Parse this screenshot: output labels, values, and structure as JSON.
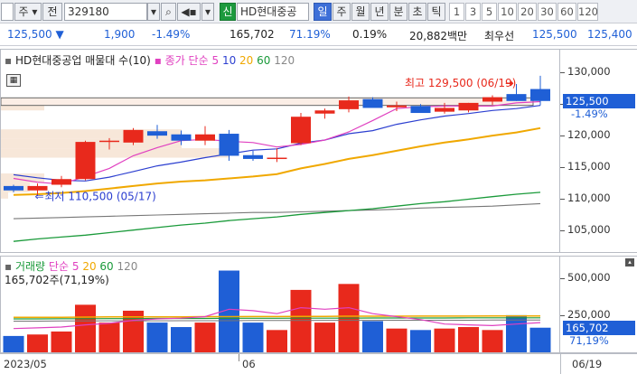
{
  "toolbar": {
    "menu_label": "주",
    "prev_label": "전",
    "code": "329180",
    "new_badge": "신",
    "stock_name": "HD현대중공",
    "periods": [
      "일",
      "주",
      "월",
      "년",
      "분",
      "초",
      "틱"
    ],
    "active_period": "일",
    "intervals": [
      "1",
      "3",
      "5",
      "10",
      "20",
      "30",
      "60",
      "120"
    ]
  },
  "quote": {
    "price": "125,500",
    "change": "1,900",
    "change_pct": "-1.49%",
    "volume": "165,702",
    "vol_ratio": "71.19%",
    "turnover": "0.19%",
    "amount": "20,882백만",
    "best_label": "최우선",
    "ask": "125,500",
    "bid": "125,400"
  },
  "price_pane": {
    "title": "HD현대중공업 매물대 수(10)",
    "ma_label": "종가 단순",
    "ma_periods": [
      "5",
      "10",
      "20",
      "60",
      "120"
    ],
    "max_annotation": "최고 129,500 (06/19)",
    "min_annotation": "최저 110,500 (05/17)",
    "current_price_tag": "125,500",
    "current_pct_tag": "-1.49%"
  },
  "volume_pane": {
    "title": "거래량",
    "ma_label": "단순",
    "ma_periods": [
      "5",
      "20",
      "60",
      "120"
    ],
    "current_info": "165,702주(71,19%)",
    "current_tag": "165,702",
    "current_pct_tag": "71,19%"
  },
  "date_axis": {
    "start": "2023/05",
    "mid": "06",
    "end": "06/19"
  },
  "colors": {
    "up": "#e8291c",
    "down": "#1f5fd6",
    "ma5": "#e040c0",
    "ma10": "#2c3fd0",
    "ma20": "#f0a800",
    "ma60": "#1a9a3a",
    "ma120": "#777777"
  },
  "chart_data": {
    "type": "candlestick",
    "dates": [
      "05/16",
      "05/17",
      "05/18",
      "05/19",
      "05/22",
      "05/23",
      "05/24",
      "05/25",
      "05/26",
      "05/30",
      "05/31",
      "06/01",
      "06/02",
      "06/05",
      "06/07",
      "06/08",
      "06/09",
      "06/12",
      "06/13",
      "06/14",
      "06/15",
      "06/16",
      "06/19"
    ],
    "ohlc": [
      [
        112000,
        112200,
        111000,
        111300
      ],
      [
        111300,
        112400,
        110500,
        112000
      ],
      [
        112200,
        113600,
        111800,
        113100
      ],
      [
        113100,
        119200,
        112900,
        119000
      ],
      [
        119000,
        119600,
        117800,
        119200
      ],
      [
        118900,
        121200,
        118500,
        120900
      ],
      [
        120700,
        121700,
        119500,
        120000
      ],
      [
        120200,
        120800,
        118500,
        119200
      ],
      [
        119200,
        121500,
        118500,
        120200
      ],
      [
        120300,
        120900,
        116000,
        116800
      ],
      [
        116900,
        117600,
        116000,
        116300
      ],
      [
        116300,
        118000,
        115800,
        116500
      ],
      [
        118800,
        123600,
        118500,
        123000
      ],
      [
        123500,
        124300,
        122700,
        124000
      ],
      [
        124200,
        126200,
        123700,
        125600
      ],
      [
        125800,
        126100,
        124600,
        124400
      ],
      [
        124500,
        125400,
        123900,
        124800
      ],
      [
        124700,
        125000,
        123600,
        123600
      ],
      [
        123800,
        125200,
        123500,
        124400
      ],
      [
        124000,
        125200,
        123700,
        125200
      ],
      [
        125400,
        126400,
        124900,
        126100
      ],
      [
        126600,
        128200,
        125500,
        125500
      ],
      [
        127400,
        129500,
        124800,
        125500
      ]
    ],
    "ma": {
      "5": [
        113200,
        112600,
        112300,
        113500,
        114800,
        116800,
        118100,
        119200,
        119400,
        119100,
        118900,
        118200,
        118600,
        119300,
        120600,
        122400,
        124300,
        124600,
        124700,
        124700,
        124700,
        125200,
        125400
      ],
      "10": [
        113800,
        113300,
        112900,
        112800,
        113400,
        114300,
        115200,
        115800,
        116500,
        117100,
        117700,
        117900,
        118800,
        119300,
        120300,
        120800,
        121800,
        122500,
        123100,
        123500,
        124000,
        124300,
        124800
      ],
      "20": [
        110600,
        110700,
        110900,
        111200,
        111600,
        112000,
        112400,
        112700,
        112900,
        113200,
        113500,
        113900,
        114800,
        115500,
        116300,
        116900,
        117600,
        118300,
        118900,
        119400,
        120000,
        120500,
        121200
      ],
      "60": [
        103200,
        103600,
        103900,
        104200,
        104600,
        105000,
        105400,
        105800,
        106100,
        106500,
        106800,
        107100,
        107500,
        107800,
        108100,
        108400,
        108800,
        109200,
        109500,
        109900,
        110300,
        110700,
        111000
      ],
      "120": [
        106800,
        106900,
        107000,
        107100,
        107200,
        107300,
        107400,
        107500,
        107600,
        107700,
        107800,
        107800,
        107900,
        108000,
        108100,
        108200,
        108300,
        108500,
        108600,
        108700,
        108800,
        109000,
        109200
      ]
    },
    "volume": [
      110000,
      120000,
      140000,
      320000,
      200000,
      280000,
      200000,
      170000,
      200000,
      550000,
      200000,
      150000,
      420000,
      200000,
      460000,
      210000,
      160000,
      150000,
      160000,
      170000,
      150000,
      250000,
      165702
    ],
    "vol_ma5": [
      160000,
      165000,
      170000,
      185000,
      195000,
      215000,
      225000,
      230000,
      240000,
      290000,
      280000,
      260000,
      300000,
      290000,
      300000,
      260000,
      240000,
      220000,
      190000,
      185000,
      180000,
      190000,
      200000
    ],
    "vol_ma20": [
      235000,
      235000,
      236000,
      237000,
      238000,
      238000,
      239000,
      239000,
      240000,
      240000,
      241000,
      241000,
      242000,
      242000,
      243000,
      243000,
      243000,
      244000,
      244000,
      244000,
      245000,
      245000,
      245000
    ],
    "vol_ma60": [
      225000,
      225000,
      226000,
      226000,
      227000,
      227000,
      228000,
      228000,
      228000,
      229000,
      229000,
      229000,
      230000,
      230000,
      230000,
      231000,
      231000,
      231000,
      231000,
      232000,
      232000,
      232000,
      232000
    ],
    "vol_ma120": [
      210000,
      210000,
      211000,
      211000,
      212000,
      212000,
      212000,
      213000,
      213000,
      213000,
      214000,
      214000,
      214000,
      215000,
      215000,
      215000,
      216000,
      216000,
      216000,
      216000,
      217000,
      217000,
      217000
    ],
    "price_ylim": [
      101800,
      132500
    ],
    "price_ticks": [
      "130,000",
      "125,000",
      "120,000",
      "115,000",
      "110,000",
      "105,000"
    ],
    "price_tick_values": [
      130000,
      125000,
      120000,
      115000,
      110000,
      105000
    ],
    "vol_ylim": [
      0,
      620000
    ],
    "vol_ticks": [
      "500,000",
      "250,000"
    ],
    "vol_tick_values": [
      500000,
      250000
    ],
    "volume_profile": [
      {
        "lo": 125000,
        "hi": 126000,
        "ratio": 0.95
      },
      {
        "lo": 124000,
        "hi": 125000,
        "ratio": 0.12
      },
      {
        "lo": 119500,
        "hi": 121000,
        "ratio": 0.5
      },
      {
        "lo": 118000,
        "hi": 119500,
        "ratio": 0.5
      },
      {
        "lo": 116500,
        "hi": 118000,
        "ratio": 0.63
      },
      {
        "lo": 112500,
        "hi": 114000,
        "ratio": 0.12
      },
      {
        "lo": 111000,
        "hi": 112500,
        "ratio": 0.08
      },
      {
        "lo": 110000,
        "hi": 111000,
        "ratio": 0.02
      }
    ]
  }
}
